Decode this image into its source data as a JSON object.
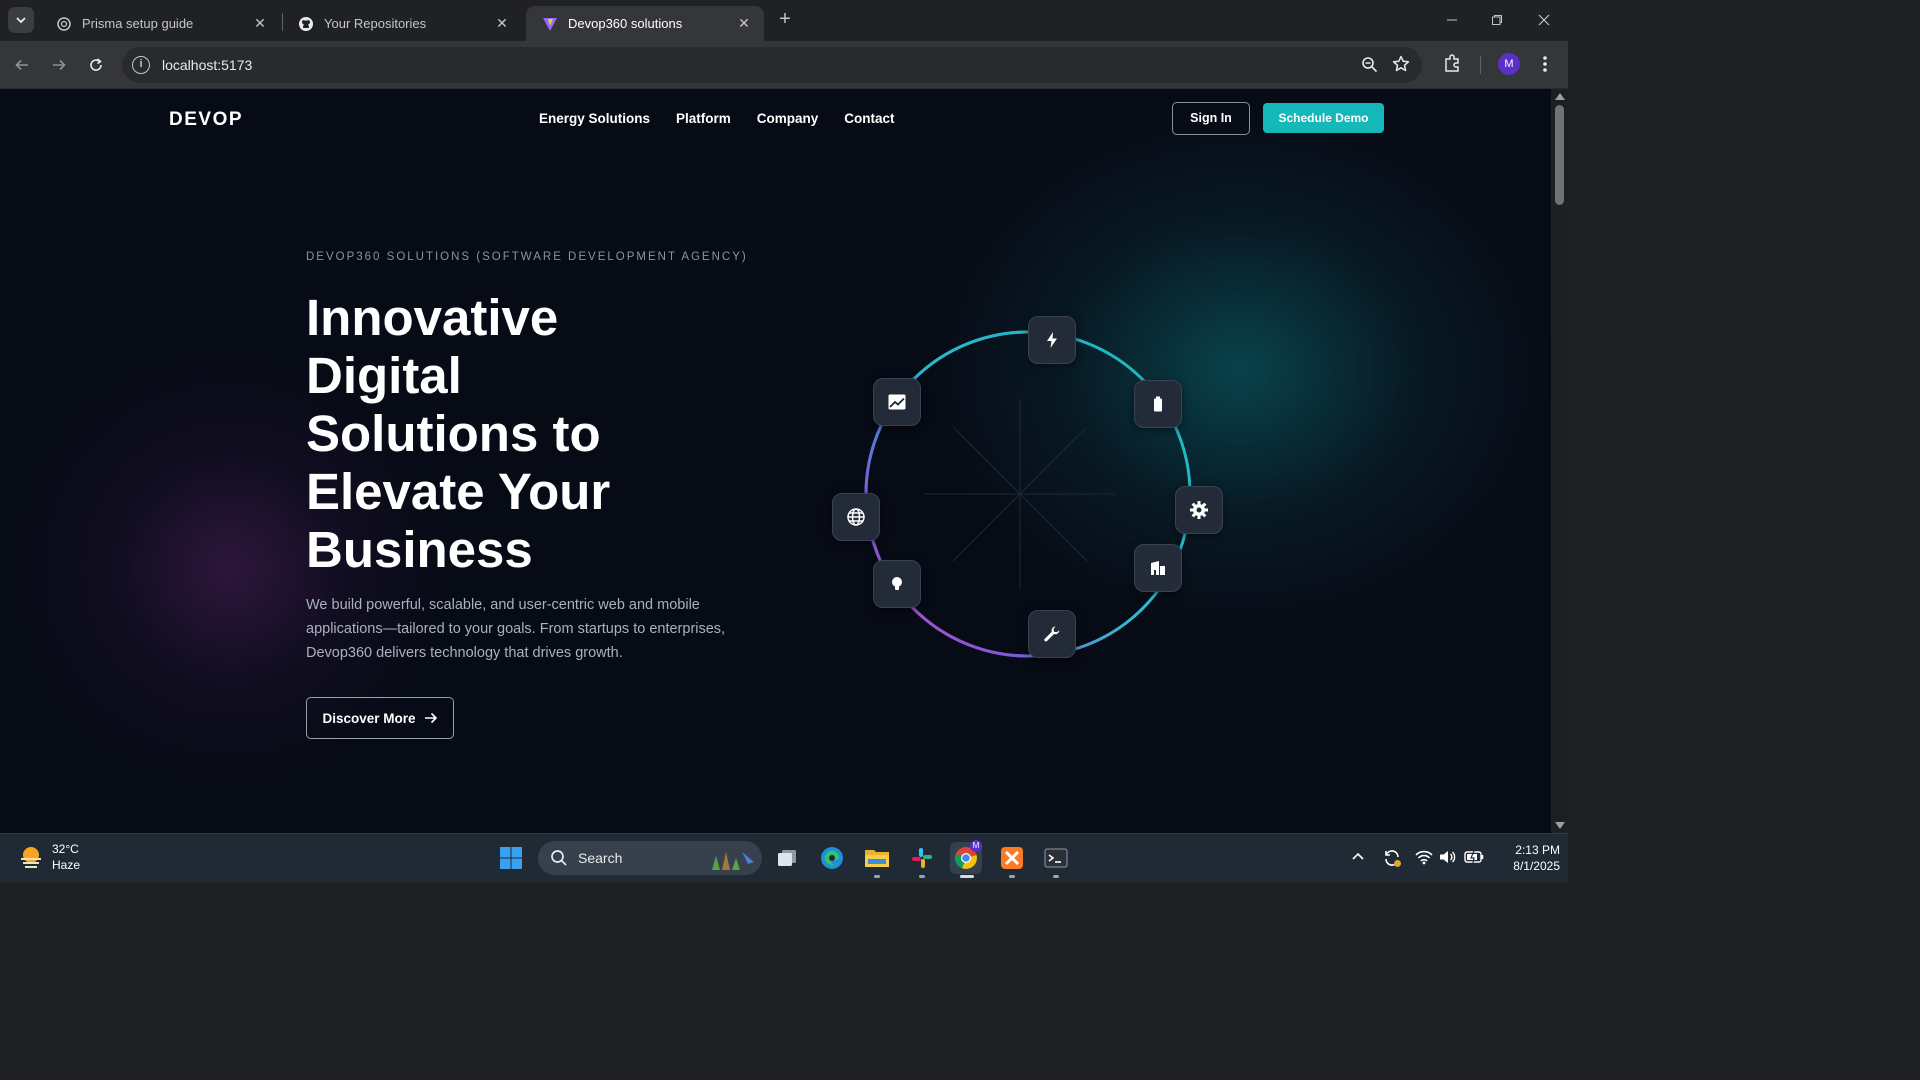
{
  "browser": {
    "tabs": [
      {
        "title": "Prisma setup guide",
        "icon": "openai-icon",
        "active": false
      },
      {
        "title": "Your Repositories",
        "icon": "github-icon",
        "active": false
      },
      {
        "title": "Devop360 solutions",
        "icon": "vite-icon",
        "active": true
      }
    ],
    "url": "localhost:5173",
    "profile_initial": "M"
  },
  "site": {
    "logo": "DEVOP",
    "nav": [
      "Energy Solutions",
      "Platform",
      "Company",
      "Contact"
    ],
    "signin_label": "Sign In",
    "demo_label": "Schedule Demo",
    "eyebrow": "DEVOP360 SOLUTIONS (SOFTWARE DEVELOPMENT AGENCY)",
    "headline_lines": [
      "Innovative",
      "Digital",
      "Solutions to",
      "Elevate Your",
      "Business"
    ],
    "description": "We build powerful, scalable, and user-centric web and mobile applications—tailored to your goals. From startups to enterprises, Devop360 delivers technology that drives growth.",
    "cta_label": "Discover More",
    "diagram_nodes": [
      "bolt-icon",
      "battery-icon",
      "gear-icon",
      "building-icon",
      "wrench-icon",
      "lightbulb-icon",
      "globe-icon",
      "chart-icon"
    ],
    "colors": {
      "accent": "#14b8b8",
      "background": "#070b16"
    }
  },
  "taskbar": {
    "weather_temp": "32°C",
    "weather_desc": "Haze",
    "search_label": "Search",
    "time": "2:13 PM",
    "date": "8/1/2025"
  }
}
